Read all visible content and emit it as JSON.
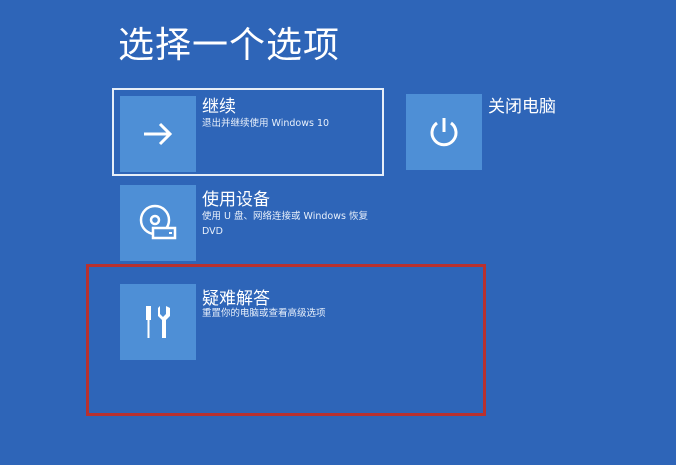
{
  "page": {
    "title": "选择一个选项"
  },
  "options": {
    "continue": {
      "title": "继续",
      "description": "退出并继续使用 Windows 10",
      "icon": "arrow-right-icon"
    },
    "shutdown": {
      "title": "关闭电脑",
      "icon": "power-icon"
    },
    "device": {
      "title": "使用设备",
      "description": "使用 U 盘、网络连接或 Windows 恢复 DVD",
      "icon": "disc-drive-icon"
    },
    "troubleshoot": {
      "title": "疑难解答",
      "description": "重置你的电脑或查看高级选项",
      "icon": "tools-icon"
    }
  },
  "colors": {
    "background": "#2e65b8",
    "tile_icon_bg": "#4e8fd6",
    "selection_border": "#e6eef8",
    "highlight_border": "#b8312f"
  }
}
